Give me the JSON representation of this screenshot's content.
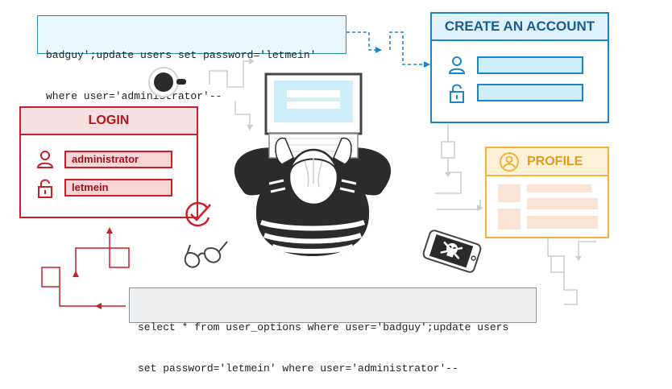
{
  "code_top": {
    "line1": "badguy';update users set password='letmein'",
    "line2": "where user='administrator'--"
  },
  "code_bottom": {
    "line1": "select * from user_options where user='badguy';update users",
    "line2": "set password='letmein' where user='administrator'--"
  },
  "create_account": {
    "title": "CREATE AN ACCOUNT",
    "username_value": "",
    "password_value": ""
  },
  "login": {
    "title": "LOGIN",
    "username_value": "administrator",
    "password_value": "letmein"
  },
  "profile": {
    "title": "PROFILE"
  },
  "colors": {
    "login_red": "#c8202a",
    "create_blue": "#1a86c7",
    "profile_orange": "#f3b136",
    "code_top_bg": "#e8f7fc",
    "code_bottom_bg": "#eceeef"
  },
  "icons": [
    "user-icon",
    "lock-icon",
    "coffee-cup-icon",
    "glasses-icon",
    "phone-skull-icon",
    "checkmark-circle-icon",
    "laptop-icon",
    "person-icon"
  ]
}
